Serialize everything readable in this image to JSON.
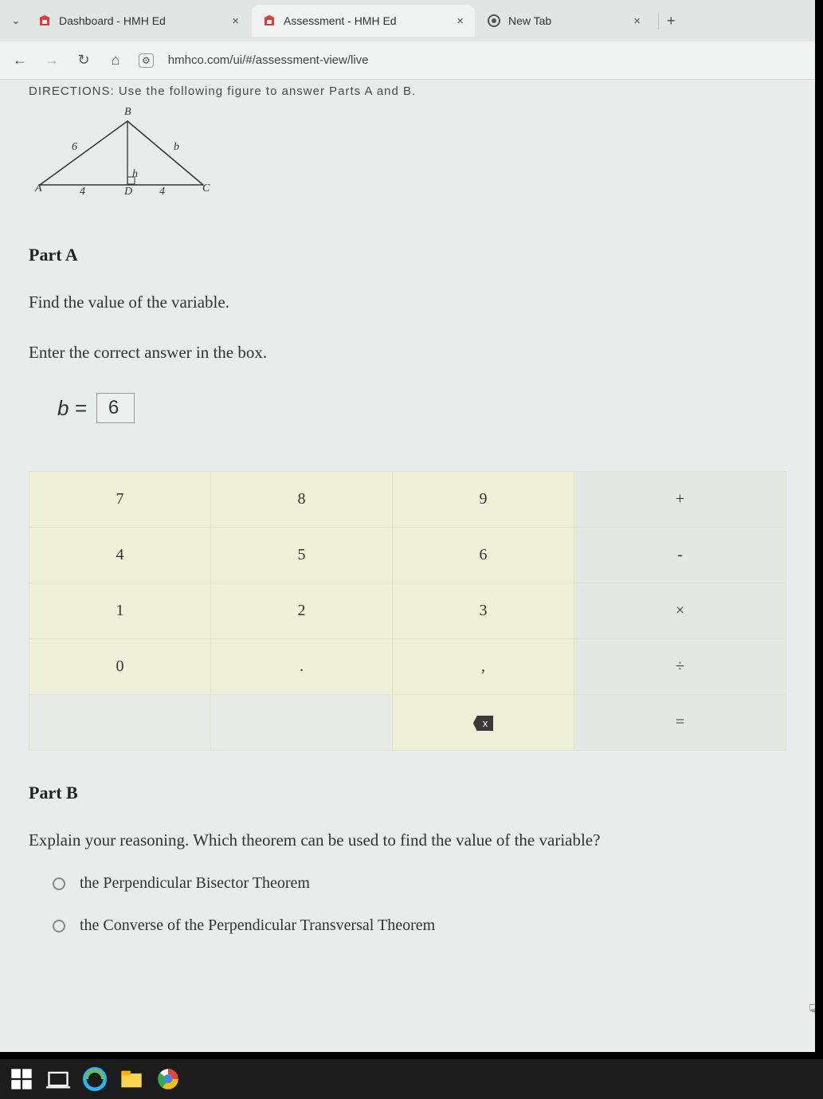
{
  "tabs": {
    "items": [
      {
        "title": "Dashboard - HMH Ed",
        "icon": "hmh",
        "active": false
      },
      {
        "title": "Assessment - HMH Ed",
        "icon": "hmh",
        "active": true
      },
      {
        "title": "New Tab",
        "icon": "newtab",
        "active": false
      }
    ],
    "close_glyph": "×",
    "add_glyph": "+",
    "menu_glyph": "⌄"
  },
  "addressbar": {
    "back_glyph": "←",
    "forward_glyph": "→",
    "reload_glyph": "↻",
    "home_glyph": "⌂",
    "url": "hmhco.com/ui/#/assessment-view/live"
  },
  "cutoff_line": "DIRECTIONS: Use the following figure to answer Parts A and B.",
  "triangle": {
    "A": "A",
    "B": "B",
    "C": "C",
    "D": "D",
    "side_left": "6",
    "side_right": "b",
    "seg_left": "4",
    "seg_right": "4",
    "height": "h"
  },
  "partA": {
    "heading": "Part A",
    "prompt1": "Find the value of the variable.",
    "prompt2": "Enter the correct answer in the box.",
    "var_label": "b =",
    "value": "6"
  },
  "keypad": {
    "rows": [
      [
        "7",
        "8",
        "9",
        "+"
      ],
      [
        "4",
        "5",
        "6",
        "-"
      ],
      [
        "1",
        "2",
        "3",
        "×"
      ],
      [
        "0",
        ".",
        ",",
        "÷"
      ],
      [
        "",
        "",
        "⌫",
        "="
      ]
    ]
  },
  "partB": {
    "heading": "Part B",
    "prompt": "Explain your reasoning. Which theorem can be used to find the value of the variable?",
    "options": [
      "the Perpendicular Bisector Theorem",
      "the Converse of the Perpendicular Transversal Theorem"
    ]
  }
}
